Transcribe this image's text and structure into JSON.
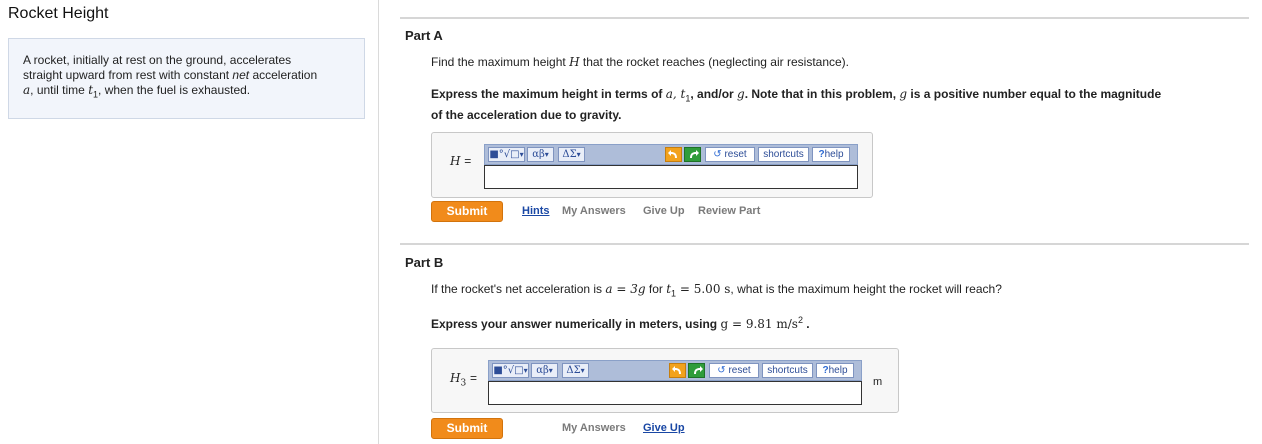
{
  "app": {
    "title": "Rocket Height"
  },
  "intro": {
    "line1": "A rocket, initially at rest on the ground, accelerates",
    "line2a": "straight upward from rest with constant ",
    "line2b": "net",
    "line2c": " acceleration",
    "line3_var_a": "a",
    "line3_mid": ", until time ",
    "line3_var_t": "t",
    "line3_sub": "1",
    "line3_end": ", when the fuel is exhausted."
  },
  "toolbar": {
    "templates_btn": "■°√□",
    "greek_btn": "αβ",
    "symbols_btn": "ΔΣ",
    "reset_label": "reset",
    "shortcuts_label": "shortcuts",
    "help_label": "help",
    "help_mark": "?",
    "dropdown_arrow": "▾"
  },
  "partA": {
    "title": "Part A",
    "question_a": "Find the maximum height ",
    "question_var": "H",
    "question_b": " that the rocket reaches (neglecting air resistance).",
    "instr_a": "Express the maximum height in terms of ",
    "instr_vars": "a, t",
    "instr_sub": "1",
    "instr_b": ", and/or ",
    "instr_g": "g",
    "instr_c": ". Note that in this problem, ",
    "instr_g2": "g",
    "instr_d": " is a positive number equal to the magnitude",
    "instr_line2": "of the acceleration due to gravity.",
    "var_label": "H",
    "var_eq": "=",
    "input_value": "",
    "submit_label": "Submit",
    "links": {
      "hints": "Hints",
      "my_answers": "My Answers",
      "give_up": "Give Up",
      "review_part": "Review Part"
    }
  },
  "partB": {
    "title": "Part B",
    "question_a": "If the rocket's net acceleration is ",
    "question_math1": "a = 3g",
    "question_b": " for ",
    "question_math2_var": "t",
    "question_math2_sub": "1",
    "question_math2_rest": " = 5.00 s",
    "question_c": ", what is the maximum height the rocket will reach?",
    "instr_a": "Express your answer numerically in meters, using ",
    "instr_math": "g = 9.81 m/s",
    "instr_sup": "2",
    "instr_end": " .",
    "var_label": "H",
    "var_sub": "3",
    "var_eq": "=",
    "input_value": "",
    "unit": "m",
    "submit_label": "Submit",
    "links": {
      "my_answers": "My Answers",
      "give_up": "Give Up"
    }
  }
}
